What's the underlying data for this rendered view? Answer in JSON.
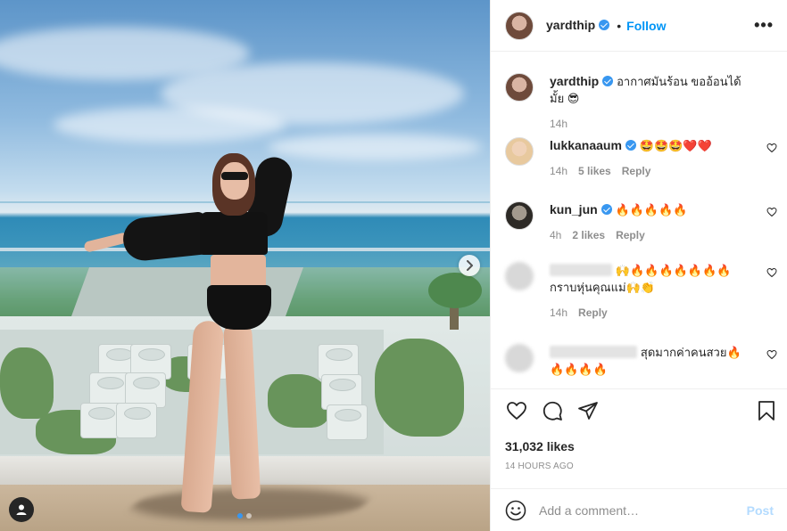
{
  "post": {
    "author": "yardthip",
    "follow_label": "Follow",
    "bullet": "•",
    "more_label": "•••",
    "caption": {
      "username": "yardthip",
      "text": "อากาศมันร้อน ขออ้อนได้มั้ย 😎",
      "time": "14h"
    },
    "image_count": 2,
    "active_image_index": 0
  },
  "comments": [
    {
      "username": "lukkanaaum",
      "verified": true,
      "text": "🤩🤩🤩❤️❤️",
      "time": "14h",
      "likes": "5 likes",
      "reply": "Reply"
    },
    {
      "username": "kun_jun",
      "verified": true,
      "text": "🔥🔥🔥🔥🔥",
      "time": "4h",
      "likes": "2 likes",
      "reply": "Reply"
    },
    {
      "username": "",
      "verified": false,
      "text": "🙌🔥🔥🔥🔥🔥🔥🔥 กราบหุ่นคุณแม่🙌👏",
      "time": "14h",
      "likes": "",
      "reply": "Reply"
    },
    {
      "username": "",
      "verified": false,
      "text": "สุดมากค่าคนสวย🔥 🔥🔥🔥🔥",
      "time": "",
      "likes": "",
      "reply": ""
    }
  ],
  "engagement": {
    "likes": "31,032 likes",
    "posted": "14 HOURS AGO"
  },
  "composer": {
    "placeholder": "Add a comment…",
    "post_label": "Post"
  },
  "colors": {
    "accent": "#0095f6",
    "verified": "#3897f0",
    "muted": "#8e8e8e"
  },
  "icons": [
    "heart-icon",
    "comment-icon",
    "share-icon",
    "bookmark-icon",
    "smile-icon",
    "chevron-right-icon",
    "user-tag-icon"
  ]
}
